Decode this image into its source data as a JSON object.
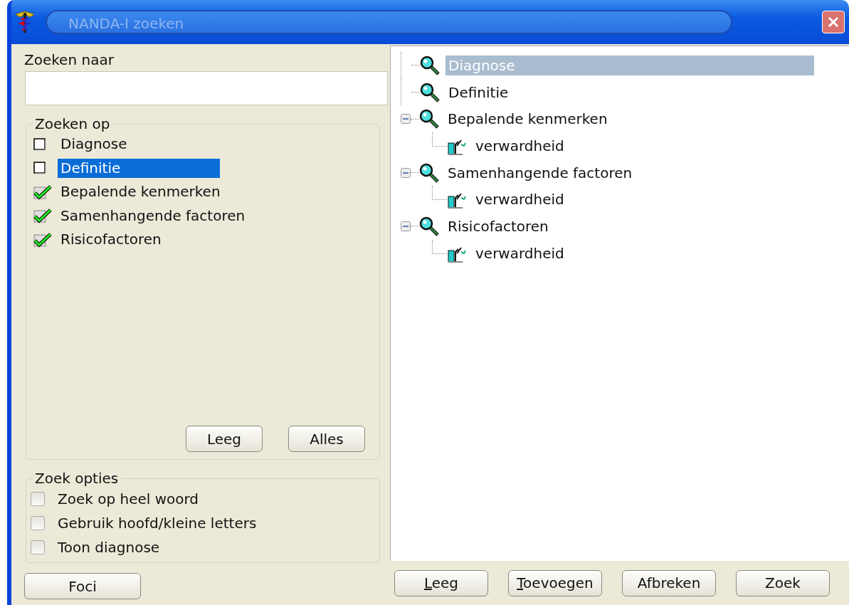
{
  "window": {
    "title": "NANDA-I zoeken"
  },
  "search": {
    "label": "Zoeken naar"
  },
  "search_on": {
    "title": "Zoeken op",
    "items": [
      {
        "label": "Diagnose",
        "checked": false,
        "selected": false
      },
      {
        "label": "Definitie",
        "checked": false,
        "selected": true
      },
      {
        "label": "Bepalende kenmerken",
        "checked": true,
        "selected": false
      },
      {
        "label": "Samenhangende factoren",
        "checked": true,
        "selected": false
      },
      {
        "label": "Risicofactoren",
        "checked": true,
        "selected": false
      }
    ],
    "buttons": [
      "Leeg",
      "Alles"
    ]
  },
  "options": {
    "title": "Zoek opties",
    "items": [
      {
        "label": "Zoek op heel woord",
        "checked": false
      },
      {
        "label": "Gebruik hoofd/kleine letters",
        "checked": false
      },
      {
        "label": "Toon diagnose",
        "checked": false
      }
    ]
  },
  "foci_button": "Foci",
  "tree": [
    {
      "label": "Diagnose",
      "selected": true
    },
    {
      "label": "Definitie",
      "selected": false
    },
    {
      "label": "Bepalende kenmerken",
      "selected": false,
      "expanded": true,
      "children": [
        {
          "label": "verwardheid",
          "selected": false
        }
      ]
    },
    {
      "label": "Samenhangende factoren",
      "selected": false,
      "expanded": true,
      "children": [
        {
          "label": "verwardheid",
          "selected": false
        }
      ]
    },
    {
      "label": "Risicofactoren",
      "selected": false,
      "expanded": true,
      "children": [
        {
          "label": "verwardheid",
          "selected": false
        }
      ]
    }
  ],
  "bottom_buttons": [
    {
      "key": "L",
      "rest": "eeg"
    },
    {
      "key": "T",
      "rest": "oevoegen"
    },
    {
      "rest": "Afbreken"
    },
    {
      "rest": "Zoek"
    }
  ]
}
